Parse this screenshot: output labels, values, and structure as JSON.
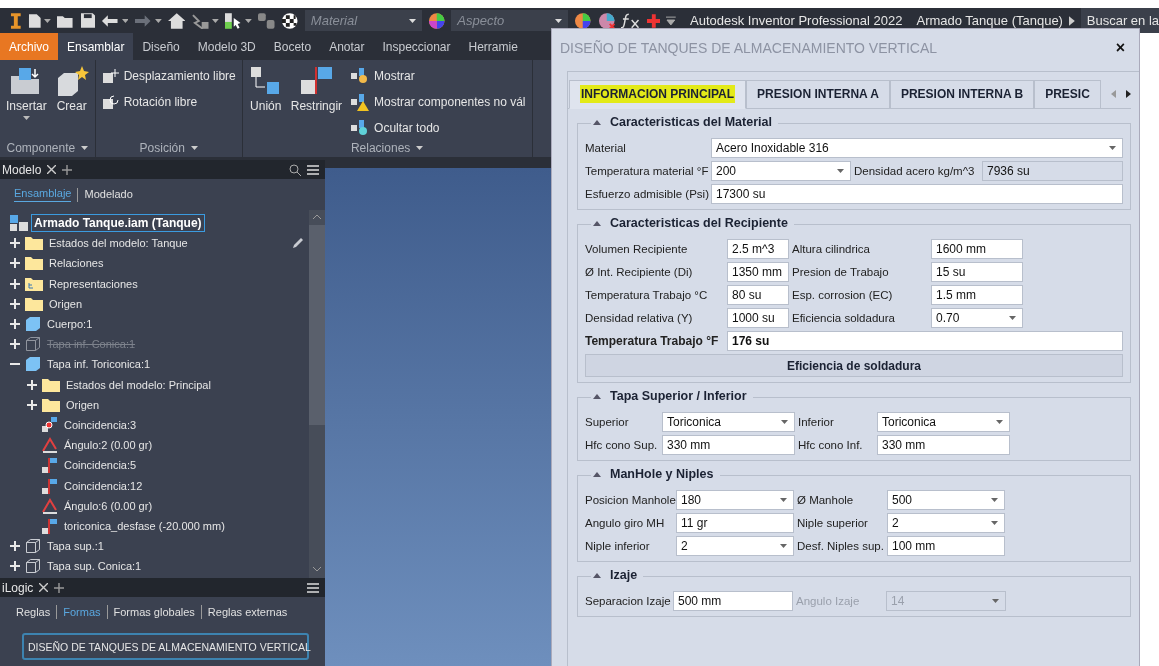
{
  "title_bar": {
    "material_combo": {
      "placeholder": "Material"
    },
    "appearance_combo": {
      "placeholder": "Aspecto"
    },
    "app_title": "Autodesk Inventor Professional 2022",
    "document_title": "Armado Tanque (Tanque)",
    "search": {
      "placeholder": "Buscar en la"
    }
  },
  "ribbon": {
    "tabs": [
      {
        "label": "Archivo",
        "kind": "file",
        "selected": false
      },
      {
        "label": "Ensamblar",
        "kind": "tab",
        "selected": true
      },
      {
        "label": "Diseño",
        "kind": "tab",
        "selected": false
      },
      {
        "label": "Modelo 3D",
        "kind": "tab",
        "selected": false
      },
      {
        "label": "Boceto",
        "kind": "tab",
        "selected": false
      },
      {
        "label": "Anotar",
        "kind": "tab",
        "selected": false
      },
      {
        "label": "Inspeccionar",
        "kind": "tab",
        "selected": false
      },
      {
        "label": "Herramie",
        "kind": "tab",
        "selected": false
      }
    ],
    "groups": [
      {
        "label": "Componente",
        "large": [
          {
            "label": "Insertar",
            "kind": "insert",
            "menu": true
          },
          {
            "label": "Crear",
            "kind": "create",
            "menu": false
          }
        ]
      },
      {
        "label": "Posición",
        "small": [
          {
            "label": "Desplazamiento libre",
            "kind": "move"
          },
          {
            "label": "Rotación libre",
            "kind": "rotate"
          }
        ]
      },
      {
        "label": "Relaciones",
        "large": [
          {
            "label": "Unión",
            "kind": "joint",
            "menu": false
          },
          {
            "label": "Restringir",
            "kind": "constrain",
            "menu": false
          }
        ],
        "small": [
          {
            "label": "Mostrar",
            "kind": "show"
          },
          {
            "label": "Mostrar componentes no vál",
            "kind": "warn"
          },
          {
            "label": "Ocultar todo",
            "kind": "hide"
          }
        ]
      }
    ]
  },
  "browser": {
    "tab": "Modelo",
    "subtabs": [
      {
        "label": "Ensamblaje",
        "selected": true
      },
      {
        "label": "Modelado",
        "selected": false
      }
    ],
    "tree": [
      {
        "label": "Armado Tanque.iam (Tanque)",
        "kind": "assembly",
        "selected": true,
        "suppressed": false,
        "children": [
          {
            "label": "Estados del modelo: Tanque",
            "kind": "folder",
            "expanded": false,
            "selected": false,
            "suppressed": false,
            "edit_icon": true
          },
          {
            "label": "Relaciones",
            "kind": "folder",
            "expanded": false,
            "selected": false,
            "suppressed": false
          },
          {
            "label": "Representaciones",
            "kind": "representations",
            "expanded": false,
            "selected": false,
            "suppressed": false
          },
          {
            "label": "Origen",
            "kind": "folder",
            "expanded": false,
            "selected": false,
            "suppressed": false
          },
          {
            "label": "Cuerpo:1",
            "kind": "part",
            "expanded": false,
            "selected": false,
            "suppressed": false
          },
          {
            "label": "Tapa inf. Conica:1",
            "kind": "part-outline",
            "expanded": false,
            "selected": false,
            "suppressed": true
          },
          {
            "label": "Tapa inf. Toriconica:1",
            "kind": "part",
            "expanded": true,
            "selected": false,
            "suppressed": false,
            "children": [
              {
                "label": "Estados del modelo: Principal",
                "kind": "folder",
                "expanded": false,
                "selected": false,
                "suppressed": false
              },
              {
                "label": "Origen",
                "kind": "folder",
                "expanded": false,
                "selected": false,
                "suppressed": false
              },
              {
                "label": "Coincidencia:3",
                "kind": "coincidence",
                "selected": false,
                "suppressed": false
              },
              {
                "label": "Ángulo:2 (0.00 gr)",
                "kind": "angle",
                "selected": false,
                "suppressed": false
              },
              {
                "label": "Coincidencia:5",
                "kind": "flush",
                "selected": false,
                "suppressed": false
              },
              {
                "label": "Coincidencia:12",
                "kind": "flush",
                "selected": false,
                "suppressed": false
              },
              {
                "label": "Ángulo:6 (0.00 gr)",
                "kind": "angle",
                "selected": false,
                "suppressed": false
              },
              {
                "label": "toriconica_desfase (-20.000 mm)",
                "kind": "flush",
                "selected": false,
                "suppressed": false
              }
            ]
          },
          {
            "label": "Tapa sup.:1",
            "kind": "part-outline",
            "expanded": false,
            "selected": false,
            "suppressed": false
          },
          {
            "label": "Tapa sup. Conica:1",
            "kind": "part-outline",
            "expanded": false,
            "selected": false,
            "suppressed": false
          }
        ]
      }
    ]
  },
  "ilogic": {
    "tab": "iLogic",
    "subtabs": [
      {
        "label": "Reglas",
        "selected": false
      },
      {
        "label": "Formas",
        "selected": true
      },
      {
        "label": "Formas globales",
        "selected": false
      },
      {
        "label": "Reglas externas",
        "selected": false
      }
    ],
    "form_button": "DISEÑO DE TANQUES DE ALMACENAMIENTO VERTICAL"
  },
  "dialog": {
    "title": "DISEÑO DE TANQUES DE ALMACENAMIENTO VERTICAL",
    "close": "×",
    "tabs": [
      {
        "label": "INFORMACION PRINCIPAL",
        "selected": true
      },
      {
        "label": "PRESION INTERNA A",
        "selected": false
      },
      {
        "label": "PRESION INTERNA B",
        "selected": false
      },
      {
        "label": "PRESIC",
        "selected": false
      }
    ],
    "sections": [
      {
        "title": "Caracteristicas del Material",
        "expanded": true,
        "rows": [
          {
            "kind": "fields",
            "bold": false,
            "fields": [
              {
                "label": "Material",
                "value": "Acero Inoxidable 316",
                "kind": "dropdown",
                "disabled": false
              }
            ]
          },
          {
            "kind": "fields",
            "bold": false,
            "fields": [
              {
                "label": "Temperatura material °F",
                "value": "200",
                "kind": "dropdown",
                "disabled": false
              },
              {
                "label": "Densidad acero kg/m^3",
                "value": "7936 su",
                "kind": "readonly",
                "disabled": false
              }
            ]
          },
          {
            "kind": "fields",
            "bold": false,
            "fields": [
              {
                "label": "Esfuerzo admisible (Psi)",
                "value": "17300 su",
                "kind": "text",
                "disabled": false
              }
            ]
          }
        ]
      },
      {
        "title": "Caracteristicas del Recipiente",
        "expanded": true,
        "rows": [
          {
            "kind": "fields",
            "bold": false,
            "fields": [
              {
                "label": "Volumen Recipiente",
                "value": "2.5 m^3",
                "kind": "text",
                "disabled": false
              },
              {
                "label": "Altura cilindrica",
                "value": "1600 mm",
                "kind": "text",
                "disabled": false
              }
            ]
          },
          {
            "kind": "fields",
            "bold": false,
            "fields": [
              {
                "label": "Ø Int. Recipiente (Di)",
                "value": "1350 mm",
                "kind": "text",
                "disabled": false
              },
              {
                "label": "Presion de Trabajo",
                "value": "15 su",
                "kind": "text",
                "disabled": false
              }
            ]
          },
          {
            "kind": "fields",
            "bold": false,
            "fields": [
              {
                "label": "Temperatura Trabajo °C",
                "value": "80 su",
                "kind": "text",
                "disabled": false
              },
              {
                "label": "Esp. corrosion (EC)",
                "value": "1.5 mm",
                "kind": "text",
                "disabled": false
              }
            ]
          },
          {
            "kind": "fields",
            "bold": false,
            "fields": [
              {
                "label": "Densidad relativa (Y)",
                "value": "1000 su",
                "kind": "text",
                "disabled": false
              },
              {
                "label": "Eficiencia soldadura",
                "value": "0.70",
                "kind": "dropdown",
                "disabled": false
              }
            ]
          },
          {
            "kind": "fields",
            "bold": true,
            "fields": [
              {
                "label": "Temperatura Trabajo °F",
                "value": "176 su",
                "kind": "text",
                "disabled": false
              }
            ]
          },
          {
            "kind": "button",
            "label": "Eficiencia de soldadura"
          }
        ]
      },
      {
        "title": "Tapa Superior / Inferior",
        "expanded": true,
        "rows": [
          {
            "kind": "fields",
            "bold": false,
            "fields": [
              {
                "label": "Superior",
                "value": "Toriconica",
                "kind": "dropdown",
                "disabled": false
              },
              {
                "label": "Inferior",
                "value": "Toriconica",
                "kind": "dropdown",
                "disabled": false
              }
            ]
          },
          {
            "kind": "fields",
            "bold": false,
            "fields": [
              {
                "label": "Hfc cono Sup.",
                "value": "330 mm",
                "kind": "text",
                "disabled": false
              },
              {
                "label": "Hfc cono Inf.",
                "value": "330 mm",
                "kind": "text",
                "disabled": false
              }
            ]
          }
        ]
      },
      {
        "title": "ManHole y Niples",
        "expanded": true,
        "rows": [
          {
            "kind": "fields",
            "bold": false,
            "fields": [
              {
                "label": "Posicion Manhole",
                "value": "180",
                "kind": "dropdown",
                "disabled": false
              },
              {
                "label": "Ø Manhole",
                "value": "500",
                "kind": "dropdown",
                "disabled": false
              }
            ]
          },
          {
            "kind": "fields",
            "bold": false,
            "fields": [
              {
                "label": "Angulo giro MH",
                "value": "11 gr",
                "kind": "text",
                "disabled": false
              },
              {
                "label": "Niple superior",
                "value": "2",
                "kind": "dropdown",
                "disabled": false
              }
            ]
          },
          {
            "kind": "fields",
            "bold": false,
            "fields": [
              {
                "label": "Niple inferior",
                "value": "2",
                "kind": "dropdown",
                "disabled": false
              },
              {
                "label": "Desf. Niples sup.",
                "value": "100 mm",
                "kind": "text",
                "disabled": false
              }
            ]
          }
        ]
      },
      {
        "title": "Izaje",
        "expanded": true,
        "rows": [
          {
            "kind": "fields",
            "bold": false,
            "fields": [
              {
                "label": "Separacion Izaje",
                "value": "500 mm",
                "kind": "text",
                "disabled": false
              },
              {
                "label": "Angulo Izaje",
                "value": "14",
                "kind": "dropdown",
                "disabled": true
              }
            ]
          }
        ]
      }
    ]
  }
}
